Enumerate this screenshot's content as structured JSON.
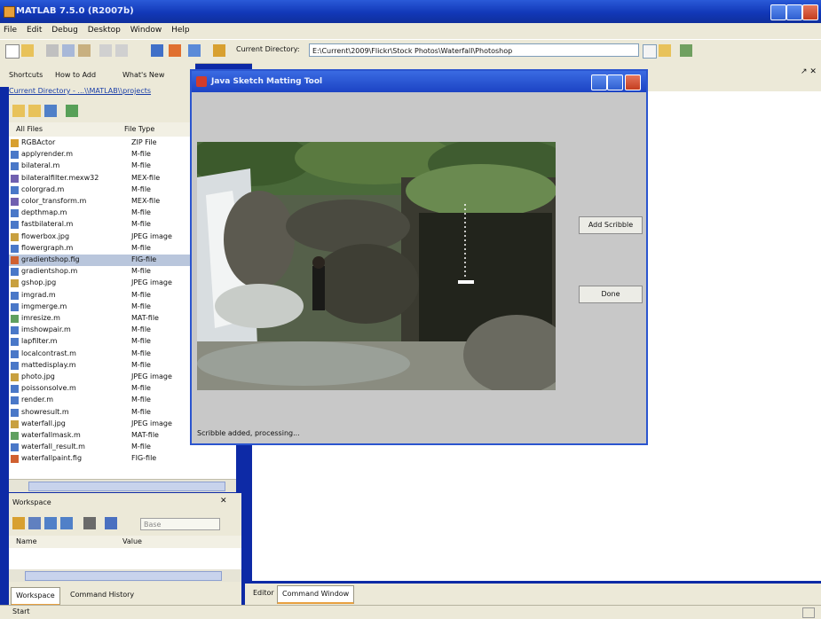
{
  "app": {
    "title": "MATLAB 7.5.0 (R2007b)"
  },
  "menu": [
    "File",
    "Edit",
    "Debug",
    "Desktop",
    "Window",
    "Help"
  ],
  "toolbar": {
    "current_directory_label": "Current Directory:",
    "current_directory_value": "E:\\Current\\2009\\Flickr\\Stock Photos\\Waterfall\\Photoshop"
  },
  "shortcuts": {
    "label1": "Shortcuts",
    "label2": "How to Add",
    "label3": "What's New"
  },
  "current_dir": {
    "text": "Current Directory - ...\\\\MATLAB\\\\projects"
  },
  "files": {
    "headers": [
      "All Files",
      "File Type"
    ],
    "rows": [
      {
        "name": "RGBActor",
        "type": "ZIP File"
      },
      {
        "name": "applyrender.m",
        "type": "M-file"
      },
      {
        "name": "bilateral.m",
        "type": "M-file"
      },
      {
        "name": "bilateralfilter.mexw32",
        "type": "MEX-file"
      },
      {
        "name": "colorgrad.m",
        "type": "M-file"
      },
      {
        "name": "color_transform.m",
        "type": "MEX-file"
      },
      {
        "name": "depthmap.m",
        "type": "M-file"
      },
      {
        "name": "fastbilateral.m",
        "type": "M-file"
      },
      {
        "name": "flowerbox.jpg",
        "type": "JPEG image"
      },
      {
        "name": "flowergraph.m",
        "type": "M-file"
      },
      {
        "name": "gradientshop.fig",
        "type": "FIG-file"
      },
      {
        "name": "gradientshop.m",
        "type": "M-file"
      },
      {
        "name": "gshop.jpg",
        "type": "JPEG image"
      },
      {
        "name": "imgrad.m",
        "type": "M-file"
      },
      {
        "name": "imgmerge.m",
        "type": "M-file"
      },
      {
        "name": "imresize.m",
        "type": "MAT-file"
      },
      {
        "name": "imshowpair.m",
        "type": "M-file"
      },
      {
        "name": "lapfilter.m",
        "type": "M-file"
      },
      {
        "name": "localcontrast.m",
        "type": "M-file"
      },
      {
        "name": "mattedisplay.m",
        "type": "M-file"
      },
      {
        "name": "photo.jpg",
        "type": "JPEG image"
      },
      {
        "name": "poissonsolve.m",
        "type": "M-file"
      },
      {
        "name": "render.m",
        "type": "M-file"
      },
      {
        "name": "showresult.m",
        "type": "M-file"
      },
      {
        "name": "waterfall.jpg",
        "type": "JPEG image"
      },
      {
        "name": "waterfallmask.m",
        "type": "MAT-file"
      },
      {
        "name": "waterfall_result.m",
        "type": "M-file"
      },
      {
        "name": "waterfallpaint.fig",
        "type": "FIG-file"
      }
    ],
    "selected_index": 10
  },
  "workspace": {
    "title": "Workspace",
    "col_name": "Name",
    "col_value": "Value",
    "stack_label": "Base"
  },
  "left_tabs": [
    "Workspace",
    "Command History"
  ],
  "right_tabs": [
    "Editor",
    "Command Window"
  ],
  "dialog": {
    "title": "Java Sketch Matting Tool",
    "buttons": [
      "Add Scribble",
      "Done"
    ],
    "status": "Scribble added, processing..."
  },
  "statusbar": {
    "start": "Start"
  }
}
